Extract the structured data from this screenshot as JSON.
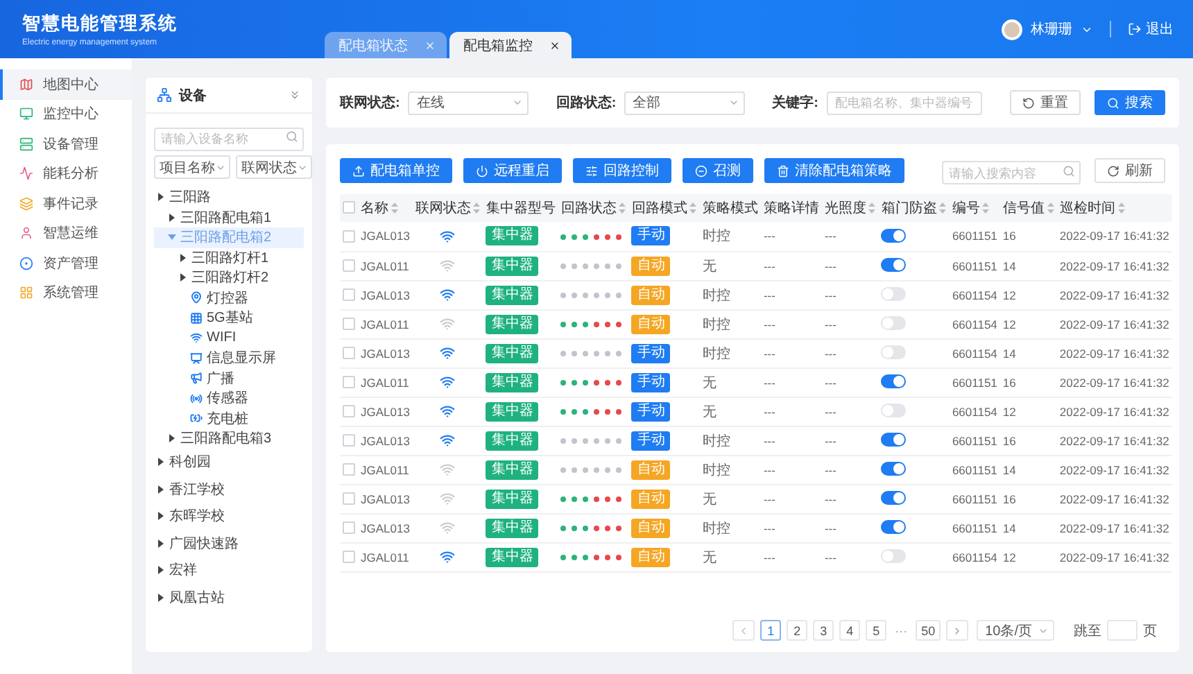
{
  "app": {
    "title": "智慧电能管理系统",
    "subtitle": "Electric energy management system"
  },
  "tabs": [
    {
      "label": "配电箱状态",
      "selected": false
    },
    {
      "label": "配电箱监控",
      "selected": true
    }
  ],
  "user": {
    "name": "林珊珊",
    "logout": "退出"
  },
  "sidebar": {
    "items": [
      {
        "label": "地图中心",
        "selected": true
      },
      {
        "label": "监控中心",
        "selected": false
      },
      {
        "label": "设备管理",
        "selected": false
      },
      {
        "label": "能耗分析",
        "selected": false
      },
      {
        "label": "事件记录",
        "selected": false
      },
      {
        "label": "智慧运维",
        "selected": false
      },
      {
        "label": "资产管理",
        "selected": false
      },
      {
        "label": "系统管理",
        "selected": false
      }
    ]
  },
  "device_tree": {
    "title": "设备",
    "search_placeholder": "请输入设备名称",
    "dropdowns": [
      "项目名称",
      "联网状态"
    ],
    "nodes": [
      {
        "label": "三阳路",
        "selected": false,
        "expanded": false,
        "children": [
          {
            "label": "三阳路配电箱1",
            "selected": false,
            "expanded": false
          },
          {
            "label": "三阳路配电箱2",
            "selected": true,
            "expanded": true,
            "children": [
              {
                "label": "三阳路灯杆1",
                "selected": false,
                "expanded": false
              },
              {
                "label": "三阳路灯杆2",
                "selected": false,
                "expanded": false,
                "children": [
                  {
                    "label": "灯控器",
                    "selected": false,
                    "kind": "pin"
                  },
                  {
                    "label": "5G基站",
                    "selected": false,
                    "kind": "grid"
                  },
                  {
                    "label": "WIFI",
                    "selected": false,
                    "kind": "wifi"
                  },
                  {
                    "label": "信息显示屏",
                    "selected": false,
                    "kind": "screen"
                  },
                  {
                    "label": "广播",
                    "selected": false,
                    "kind": "speaker"
                  },
                  {
                    "label": "传感器",
                    "selected": false,
                    "kind": "sensor"
                  },
                  {
                    "label": "充电桩",
                    "selected": false,
                    "kind": "charger"
                  }
                ]
              }
            ]
          },
          {
            "label": "三阳路配电箱3",
            "selected": false,
            "expanded": false
          }
        ]
      },
      {
        "label": "科创园",
        "selected": false,
        "expanded": false
      },
      {
        "label": "香江学校",
        "selected": false,
        "expanded": false
      },
      {
        "label": "东晖学校",
        "selected": false,
        "expanded": false
      },
      {
        "label": "广园快速路",
        "selected": false,
        "expanded": false
      },
      {
        "label": "宏祥",
        "selected": false,
        "expanded": false
      },
      {
        "label": "凤凰古站",
        "selected": false,
        "expanded": false
      }
    ]
  },
  "filters": [
    {
      "kind": "select",
      "label": "联网状态:",
      "value": "在线"
    },
    {
      "kind": "select",
      "label": "回路状态:",
      "value": "全部"
    },
    {
      "kind": "input",
      "label": "关键字:",
      "placeholder": "配电箱名称、集中器编号"
    }
  ],
  "filter_buttons": [
    {
      "kind": "reset",
      "label": "重置"
    },
    {
      "kind": "search",
      "label": "搜索"
    }
  ],
  "actions": [
    {
      "kind": "upload",
      "label": "配电箱单控"
    },
    {
      "kind": "power",
      "label": "远程重启"
    },
    {
      "kind": "sliders",
      "label": "回路控制"
    },
    {
      "kind": "minus",
      "label": "召测"
    },
    {
      "kind": "trash",
      "label": "清除配电箱策略"
    }
  ],
  "table_search": {
    "placeholder": "请输入搜索内容"
  },
  "refresh": "刷新",
  "table": {
    "select_all": false,
    "columns": [
      {
        "label": "名称",
        "sortable": true
      },
      {
        "label": "联网状态",
        "sortable": true
      },
      {
        "label": "集中器型号",
        "sortable": false
      },
      {
        "label": "回路状态",
        "sortable": true
      },
      {
        "label": "回路模式",
        "sortable": true
      },
      {
        "label": "策略模式",
        "sortable": false
      },
      {
        "label": "策略详情",
        "sortable": false
      },
      {
        "label": "光照度",
        "sortable": true
      },
      {
        "label": "箱门防盗",
        "sortable": true
      },
      {
        "label": "编号",
        "sortable": true
      },
      {
        "label": "信号值",
        "sortable": true
      },
      {
        "label": "巡检时间",
        "sortable": true
      }
    ],
    "rows": [
      {
        "checked": false,
        "name": "JGAL013",
        "online": true,
        "concentrator": "集中器",
        "loops": [
          {
            "color": "#2bb37a"
          },
          {
            "color": "#2bb37a"
          },
          {
            "color": "#2bb37a"
          },
          {
            "color": "#e5484d"
          },
          {
            "color": "#e5484d"
          },
          {
            "color": "#e5484d"
          }
        ],
        "mode": {
          "label": "手动",
          "kind": "manual"
        },
        "strategy": "时控",
        "detail": "---",
        "lux": "---",
        "door_guard": true,
        "number": "6601151",
        "signal": "16",
        "time": "2022-09-17 16:41:32"
      },
      {
        "checked": false,
        "name": "JGAL011",
        "online": false,
        "concentrator": "集中器",
        "loops": [
          {
            "color": "#c0c4cc"
          },
          {
            "color": "#c0c4cc"
          },
          {
            "color": "#c0c4cc"
          },
          {
            "color": "#c0c4cc"
          },
          {
            "color": "#c0c4cc"
          },
          {
            "color": "#c0c4cc"
          }
        ],
        "mode": {
          "label": "自动",
          "kind": "auto"
        },
        "strategy": "无",
        "detail": "---",
        "lux": "---",
        "door_guard": true,
        "number": "6601151",
        "signal": "14",
        "time": "2022-09-17 16:41:32"
      },
      {
        "checked": false,
        "name": "JGAL013",
        "online": true,
        "concentrator": "集中器",
        "loops": [
          {
            "color": "#c0c4cc"
          },
          {
            "color": "#c0c4cc"
          },
          {
            "color": "#c0c4cc"
          },
          {
            "color": "#c0c4cc"
          },
          {
            "color": "#c0c4cc"
          },
          {
            "color": "#c0c4cc"
          }
        ],
        "mode": {
          "label": "自动",
          "kind": "auto"
        },
        "strategy": "时控",
        "detail": "---",
        "lux": "---",
        "door_guard": false,
        "number": "6601154",
        "signal": "12",
        "time": "2022-09-17 16:41:32"
      },
      {
        "checked": false,
        "name": "JGAL011",
        "online": false,
        "concentrator": "集中器",
        "loops": [
          {
            "color": "#2bb37a"
          },
          {
            "color": "#2bb37a"
          },
          {
            "color": "#2bb37a"
          },
          {
            "color": "#e5484d"
          },
          {
            "color": "#e5484d"
          },
          {
            "color": "#e5484d"
          }
        ],
        "mode": {
          "label": "自动",
          "kind": "auto"
        },
        "strategy": "时控",
        "detail": "---",
        "lux": "---",
        "door_guard": false,
        "number": "6601154",
        "signal": "12",
        "time": "2022-09-17 16:41:32"
      },
      {
        "checked": false,
        "name": "JGAL013",
        "online": true,
        "concentrator": "集中器",
        "loops": [
          {
            "color": "#c0c4cc"
          },
          {
            "color": "#c0c4cc"
          },
          {
            "color": "#c0c4cc"
          },
          {
            "color": "#c0c4cc"
          },
          {
            "color": "#c0c4cc"
          },
          {
            "color": "#c0c4cc"
          }
        ],
        "mode": {
          "label": "手动",
          "kind": "manual"
        },
        "strategy": "时控",
        "detail": "---",
        "lux": "---",
        "door_guard": false,
        "number": "6601154",
        "signal": "14",
        "time": "2022-09-17 16:41:32"
      },
      {
        "checked": false,
        "name": "JGAL011",
        "online": true,
        "concentrator": "集中器",
        "loops": [
          {
            "color": "#2bb37a"
          },
          {
            "color": "#2bb37a"
          },
          {
            "color": "#2bb37a"
          },
          {
            "color": "#e5484d"
          },
          {
            "color": "#e5484d"
          },
          {
            "color": "#e5484d"
          }
        ],
        "mode": {
          "label": "手动",
          "kind": "manual"
        },
        "strategy": "无",
        "detail": "---",
        "lux": "---",
        "door_guard": true,
        "number": "6601151",
        "signal": "16",
        "time": "2022-09-17 16:41:32"
      },
      {
        "checked": false,
        "name": "JGAL013",
        "online": true,
        "concentrator": "集中器",
        "loops": [
          {
            "color": "#2bb37a"
          },
          {
            "color": "#2bb37a"
          },
          {
            "color": "#2bb37a"
          },
          {
            "color": "#e5484d"
          },
          {
            "color": "#e5484d"
          },
          {
            "color": "#e5484d"
          }
        ],
        "mode": {
          "label": "手动",
          "kind": "manual"
        },
        "strategy": "无",
        "detail": "---",
        "lux": "---",
        "door_guard": false,
        "number": "6601154",
        "signal": "12",
        "time": "2022-09-17 16:41:32"
      },
      {
        "checked": false,
        "name": "JGAL013",
        "online": true,
        "concentrator": "集中器",
        "loops": [
          {
            "color": "#c0c4cc"
          },
          {
            "color": "#c0c4cc"
          },
          {
            "color": "#c0c4cc"
          },
          {
            "color": "#c0c4cc"
          },
          {
            "color": "#c0c4cc"
          },
          {
            "color": "#c0c4cc"
          }
        ],
        "mode": {
          "label": "手动",
          "kind": "manual"
        },
        "strategy": "时控",
        "detail": "---",
        "lux": "---",
        "door_guard": true,
        "number": "6601151",
        "signal": "16",
        "time": "2022-09-17 16:41:32"
      },
      {
        "checked": false,
        "name": "JGAL011",
        "online": false,
        "concentrator": "集中器",
        "loops": [
          {
            "color": "#c0c4cc"
          },
          {
            "color": "#c0c4cc"
          },
          {
            "color": "#c0c4cc"
          },
          {
            "color": "#c0c4cc"
          },
          {
            "color": "#c0c4cc"
          },
          {
            "color": "#c0c4cc"
          }
        ],
        "mode": {
          "label": "自动",
          "kind": "auto"
        },
        "strategy": "时控",
        "detail": "---",
        "lux": "---",
        "door_guard": true,
        "number": "6601151",
        "signal": "14",
        "time": "2022-09-17 16:41:32"
      },
      {
        "checked": false,
        "name": "JGAL013",
        "online": false,
        "concentrator": "集中器",
        "loops": [
          {
            "color": "#2bb37a"
          },
          {
            "color": "#2bb37a"
          },
          {
            "color": "#2bb37a"
          },
          {
            "color": "#e5484d"
          },
          {
            "color": "#e5484d"
          },
          {
            "color": "#e5484d"
          }
        ],
        "mode": {
          "label": "自动",
          "kind": "auto"
        },
        "strategy": "无",
        "detail": "---",
        "lux": "---",
        "door_guard": true,
        "number": "6601151",
        "signal": "16",
        "time": "2022-09-17 16:41:32"
      },
      {
        "checked": false,
        "name": "JGAL013",
        "online": false,
        "concentrator": "集中器",
        "loops": [
          {
            "color": "#2bb37a"
          },
          {
            "color": "#2bb37a"
          },
          {
            "color": "#2bb37a"
          },
          {
            "color": "#e5484d"
          },
          {
            "color": "#e5484d"
          },
          {
            "color": "#e5484d"
          }
        ],
        "mode": {
          "label": "自动",
          "kind": "auto"
        },
        "strategy": "时控",
        "detail": "---",
        "lux": "---",
        "door_guard": true,
        "number": "6601151",
        "signal": "14",
        "time": "2022-09-17 16:41:32"
      },
      {
        "checked": false,
        "name": "JGAL011",
        "online": true,
        "concentrator": "集中器",
        "loops": [
          {
            "color": "#2bb37a"
          },
          {
            "color": "#2bb37a"
          },
          {
            "color": "#2bb37a"
          },
          {
            "color": "#e5484d"
          },
          {
            "color": "#e5484d"
          },
          {
            "color": "#e5484d"
          }
        ],
        "mode": {
          "label": "自动",
          "kind": "auto"
        },
        "strategy": "无",
        "detail": "---",
        "lux": "---",
        "door_guard": false,
        "number": "6601154",
        "signal": "12",
        "time": "2022-09-17 16:41:32"
      }
    ]
  },
  "pagination": {
    "pages": [
      {
        "kind": "page",
        "label": "1",
        "selected": true
      },
      {
        "kind": "page",
        "label": "2",
        "selected": false
      },
      {
        "kind": "page",
        "label": "3",
        "selected": false
      },
      {
        "kind": "page",
        "label": "4",
        "selected": false
      },
      {
        "kind": "page",
        "label": "5",
        "selected": false
      },
      {
        "kind": "ellipsis",
        "label": "···",
        "selected": false
      },
      {
        "kind": "page",
        "label": "50",
        "selected": false
      }
    ],
    "page_size": "10条/页",
    "jump_label": "跳至",
    "jump_suffix": "页"
  }
}
